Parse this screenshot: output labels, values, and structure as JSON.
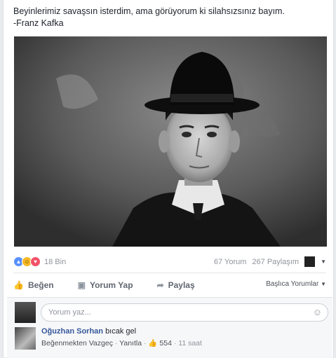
{
  "post": {
    "quote_line1": "Beyinlerimiz savaşsın isterdim, ama görüyorum ki silahsızsınız bayım.",
    "quote_line2": "-Franz Kafka"
  },
  "stats": {
    "reaction_count": "18 Bin",
    "comments": "67 Yorum",
    "shares": "267 Paylaşım"
  },
  "actions": {
    "like": "Beğen",
    "comment": "Yorum Yap",
    "share": "Paylaş",
    "order": "Başlıca Yorumlar"
  },
  "composer": {
    "placeholder": "Yorum yaz..."
  },
  "comment": {
    "author": "Oğuzhan Sorhan",
    "text": "bıcak gel",
    "unlike": "Beğenmekten Vazgeç",
    "reply": "Yanıtla",
    "likes": "554",
    "time": "11 saat"
  },
  "colors": {
    "brand": "#365899",
    "like": "#5890ff",
    "love": "#f25268"
  }
}
